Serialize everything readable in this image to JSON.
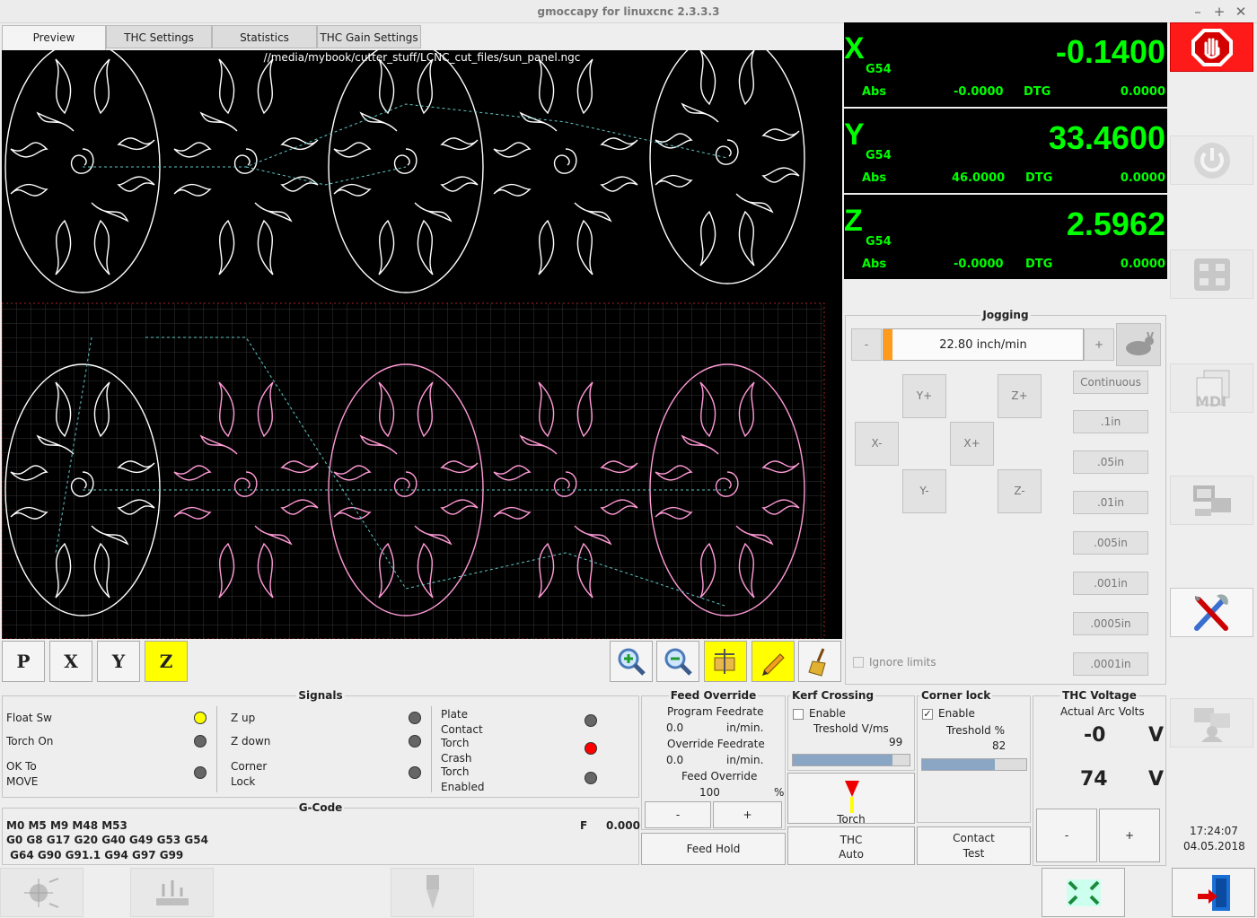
{
  "window": {
    "title": "gmoccapy for linuxcnc  2.3.3.3",
    "controls": [
      "–",
      "+",
      "✕"
    ]
  },
  "tabs": [
    {
      "label": "Preview",
      "active": true
    },
    {
      "label": "THC Settings"
    },
    {
      "label": "Statistics"
    },
    {
      "label": "THC Gain Settings"
    }
  ],
  "preview": {
    "file_path": "//media/mybook/cutter_stuff/LCNC_cut_files/sun_panel.ngc"
  },
  "view_buttons": [
    "P",
    "X",
    "Y",
    "Z"
  ],
  "dro": {
    "x": {
      "axis": "X",
      "coord": "G54",
      "value": "-0.1400",
      "abs_label": "Abs",
      "abs": "-0.0000",
      "dtg_label": "DTG",
      "dtg": "0.0000"
    },
    "y": {
      "axis": "Y",
      "coord": "G54",
      "value": "33.4600",
      "abs_label": "Abs",
      "abs": "46.0000",
      "dtg_label": "DTG",
      "dtg": "0.0000"
    },
    "z": {
      "axis": "Z",
      "coord": "G54",
      "value": "2.5962",
      "abs_label": "Abs",
      "abs": "-0.0000",
      "dtg_label": "DTG",
      "dtg": "0.0000"
    }
  },
  "jogging": {
    "title": "Jogging",
    "minus": "-",
    "plus": "+",
    "speed": "22.80 inch/min",
    "buttons": {
      "yplus": "Y+",
      "zplus": "Z+",
      "xminus": "X-",
      "xplus": "X+",
      "yminus": "Y-",
      "zminus": "Z-"
    },
    "increments": [
      "Continuous",
      ".1in",
      ".05in",
      ".01in",
      ".005in",
      ".001in",
      ".0005in",
      ".0001in"
    ],
    "ignore_limits": "Ignore limits"
  },
  "signals": {
    "title": "Signals",
    "col1": [
      "Float Sw",
      "Torch On",
      "OK To\nMOVE"
    ],
    "col2": [
      "Z up",
      "Z down",
      "Corner\nLock"
    ],
    "col3": [
      "Plate\nContact",
      "Torch\nCrash",
      "Torch\nEnabled"
    ],
    "led_colors": {
      "on_yellow": "#ffff00",
      "off": "#666666",
      "red": "#ff0000"
    }
  },
  "gcode": {
    "title": "G-Code",
    "line1": "M0 M5 M9 M48 M53",
    "line2": "G0 G8 G17 G20 G40 G49 G53 G54",
    "line3": " G64 G90 G91.1 G94 G97 G99",
    "f_label": "F",
    "f_value": "0.000"
  },
  "feed_override": {
    "title": "Feed Override",
    "program_feedrate": "Program Feedrate",
    "pf_value": "0.0",
    "pf_unit": "in/min.",
    "override_feedrate": "Override Feedrate",
    "of_value": "0.0",
    "of_unit": "in/min.",
    "feed_override": "Feed Override",
    "fo_value": "100",
    "fo_unit": "%",
    "minus": "-",
    "plus": "+",
    "feed_hold": "Feed Hold"
  },
  "kerf": {
    "title": "Kerf Crossing",
    "enable": "Enable",
    "threshold_label": "Treshold  V/ms",
    "threshold": "99",
    "level": 0.85,
    "torch_enable": "Torch\nEnable",
    "thc_auto": "THC\nAuto"
  },
  "corner": {
    "title": "Corner lock",
    "enable": "Enable",
    "threshold_label": "Treshold %",
    "threshold": "82",
    "level": 0.7,
    "contact_test": "Contact\nTest"
  },
  "thc_voltage": {
    "title": "THC Voltage",
    "actual": "Actual Arc Volts",
    "value1": "-0",
    "unit1": "V",
    "value2": "74",
    "unit2": "V",
    "minus": "-",
    "plus": "+"
  },
  "clock": {
    "time": "17:24:07",
    "date": "04.05.2018"
  },
  "icons": {
    "estop": "estop-hand-icon",
    "power": "power-icon",
    "ref": "home-all-icon",
    "mdi": "mdi-icon",
    "auto": "auto-mode-icon",
    "settings": "settings-tools-icon",
    "user": "user-tabs-icon",
    "exit": "exit-door-icon",
    "fullscreen": "fullscreen-icon"
  },
  "colors": {
    "dro_green": "#00ff00",
    "estop_red": "#ff1a1a",
    "highlight_yellow": "#ffff00"
  }
}
